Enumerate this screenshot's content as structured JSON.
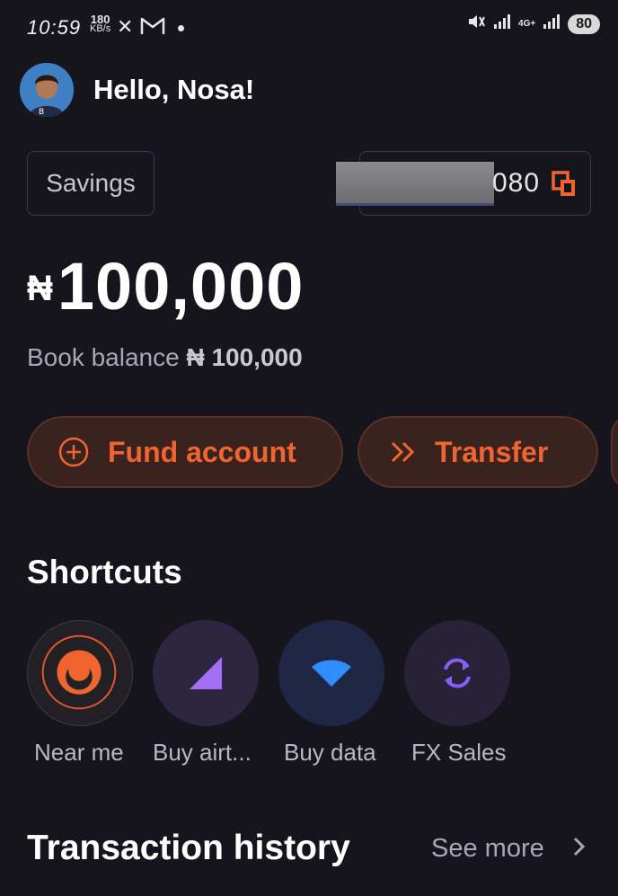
{
  "status_bar": {
    "time": "10:59",
    "net_speed": "180",
    "net_speed_unit": "KB/s",
    "net_type": "4G+",
    "battery": "80"
  },
  "header": {
    "greeting": "Hello, Nosa!"
  },
  "account": {
    "type": "Savings",
    "number_suffix": "080"
  },
  "balance": {
    "currency": "₦",
    "amount": "100,000",
    "book_label": "Book balance",
    "book_amount": "₦ 100,000"
  },
  "actions": {
    "fund_label": "Fund account",
    "transfer_label": "Transfer"
  },
  "shortcuts": {
    "title": "Shortcuts",
    "items": [
      {
        "label": "Near me",
        "icon": "near-me-icon"
      },
      {
        "label": "Buy airt...",
        "icon": "airtime-signal-icon"
      },
      {
        "label": "Buy data",
        "icon": "wifi-data-icon"
      },
      {
        "label": "FX Sales",
        "icon": "fx-exchange-icon"
      }
    ]
  },
  "transactions": {
    "title": "Transaction history",
    "see_more": "See more"
  },
  "colors": {
    "background": "#16151d",
    "accent": "#f0652f",
    "button_bg": "#3a221e"
  }
}
